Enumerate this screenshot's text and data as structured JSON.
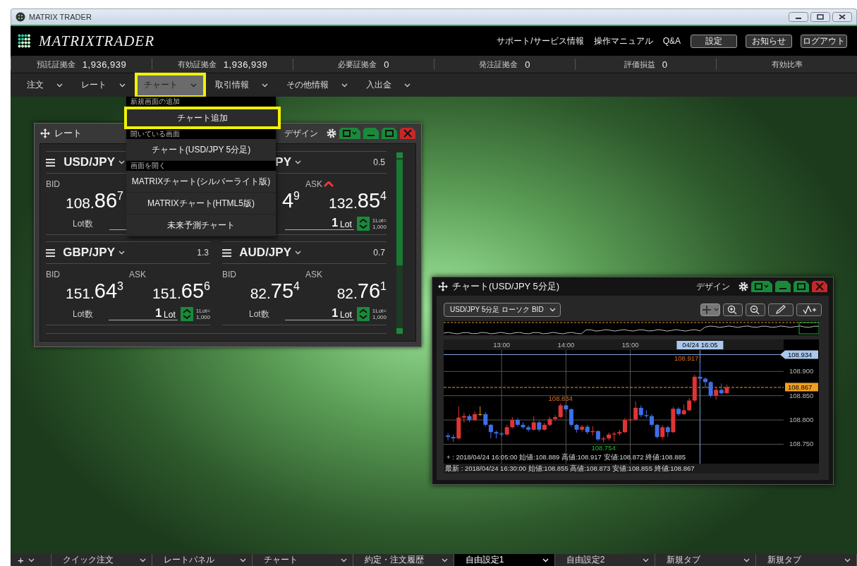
{
  "window": {
    "title": "MATRIX TRADER"
  },
  "header": {
    "logo": "MATRIXTRADER",
    "links": [
      "サポート/サービス情報",
      "操作マニュアル",
      "Q&A"
    ],
    "buttons": [
      "設定",
      "お知らせ",
      "ログアウト"
    ]
  },
  "account": [
    {
      "label": "預託証拠金",
      "value": "1,936,939"
    },
    {
      "label": "有効証拠金",
      "value": "1,936,939"
    },
    {
      "label": "必要証拠金",
      "value": "0"
    },
    {
      "label": "発注証拠金",
      "value": "0"
    },
    {
      "label": "評価損益",
      "value": "0"
    },
    {
      "label": "有効比率"
    }
  ],
  "menu": [
    {
      "label": "注文",
      "selected": false,
      "highlighted": false
    },
    {
      "label": "レート",
      "selected": false,
      "highlighted": false
    },
    {
      "label": "チャート",
      "selected": true,
      "highlighted": true
    },
    {
      "label": "取引情報",
      "selected": false,
      "highlighted": false
    },
    {
      "label": "その他情報",
      "selected": false,
      "highlighted": false
    },
    {
      "label": "入出金",
      "selected": false,
      "highlighted": false
    }
  ],
  "dropdown": [
    {
      "kind": "header",
      "label": "新規画面の追加"
    },
    {
      "kind": "item",
      "label": "チャート追加",
      "highlighted": true
    },
    {
      "kind": "header",
      "label": "開いている画面"
    },
    {
      "kind": "item",
      "label": "チャート(USD/JPY 5分足)",
      "highlighted": false
    },
    {
      "kind": "header",
      "label": "画面を開く"
    },
    {
      "kind": "item",
      "label": "MATRIXチャート(シルバーライト版)",
      "highlighted": false
    },
    {
      "kind": "item",
      "label": "MATRIXチャート(HTML5版)",
      "highlighted": false
    },
    {
      "kind": "item",
      "label": "未来予測チャート",
      "highlighted": false
    }
  ],
  "rate_window": {
    "title": "レート",
    "design": "デザイン",
    "pairs": [
      {
        "pair": "USD/JPY",
        "menu_icon": true,
        "bid": {
          "label": "BID",
          "int": "108.",
          "main": "86",
          "pip": "7",
          "rising": false
        },
        "lot": {
          "label": "Lot数"
        }
      },
      {
        "pair": "PY",
        "menu_icon": false,
        "spread": "0.5",
        "bid": {
          "main": "4",
          "pip": "9"
        },
        "ask": {
          "label": "ASK",
          "int": "132.",
          "main": "85",
          "pip": "4",
          "rising": true
        },
        "lot": {
          "value": "1",
          "unit": "Lot",
          "note": "1Lot=",
          "note_value": "1,000"
        }
      },
      {
        "pair": "GBP/JPY",
        "menu_icon": true,
        "spread": "1.3",
        "bid": {
          "label": "BID",
          "int": "151.",
          "main": "64",
          "pip": "3",
          "rising": false
        },
        "ask": {
          "label": "ASK",
          "int": "151.",
          "main": "65",
          "pip": "6",
          "rising": false
        },
        "lot": {
          "label": "Lot数",
          "value": "1",
          "unit": "Lot",
          "note": "1Lot=",
          "note_value": "1,000"
        }
      },
      {
        "pair": "AUD/JPY",
        "menu_icon": true,
        "spread": "0.7",
        "bid": {
          "label": "BID",
          "int": "82.",
          "main": "75",
          "pip": "4",
          "rising": false
        },
        "ask": {
          "label": "ASK",
          "int": "82.",
          "main": "76",
          "pip": "1",
          "rising": false
        },
        "lot": {
          "label": "Lot数",
          "value": "1",
          "unit": "Lot",
          "note": "1Lot=",
          "note_value": "1,000"
        }
      }
    ]
  },
  "chart_window": {
    "title": "チャート(USD/JPY 5分足)",
    "design": "デザイン",
    "selector": "USD/JPY 5分足 ローソク BID",
    "cursor_info": "+ : 2018/04/24 16:05:00 始値:108.889 高値:108.917 安値:108.872 終値:108.885",
    "latest_info": "最新 : 2018/04/24 16:30:00 始値:108.855 高値:108.873 安値:108.855 終値:108.867",
    "chart_data": {
      "type": "candlestick",
      "x": [
        730,
        735,
        740,
        745,
        750,
        755,
        760,
        765,
        770,
        775,
        780,
        785,
        790,
        795,
        800,
        805,
        810,
        815,
        820,
        825,
        830,
        835,
        840,
        845,
        850,
        855,
        860,
        865,
        870,
        875,
        880,
        885,
        890,
        895,
        900,
        905,
        910,
        915,
        920,
        925,
        930,
        935,
        940,
        945,
        950,
        955,
        960,
        965,
        970,
        975,
        980,
        985,
        990
      ],
      "ohlc": [
        [
          108.768,
          108.772,
          108.758,
          108.765
        ],
        [
          108.765,
          108.77,
          108.755,
          108.762
        ],
        [
          108.762,
          108.828,
          108.76,
          108.805
        ],
        [
          108.805,
          108.815,
          108.795,
          108.808
        ],
        [
          108.808,
          108.812,
          108.796,
          108.8
        ],
        [
          108.8,
          108.818,
          108.798,
          108.812
        ],
        [
          108.812,
          108.828,
          108.808,
          108.812
        ],
        [
          108.812,
          108.816,
          108.786,
          108.79
        ],
        [
          108.79,
          108.792,
          108.762,
          108.775
        ],
        [
          108.775,
          108.778,
          108.762,
          108.772
        ],
        [
          108.772,
          108.775,
          108.766,
          108.77
        ],
        [
          108.77,
          108.79,
          108.768,
          108.785
        ],
        [
          108.785,
          108.806,
          108.783,
          108.8
        ],
        [
          108.8,
          108.804,
          108.786,
          108.79
        ],
        [
          108.79,
          108.795,
          108.782,
          108.785
        ],
        [
          108.785,
          108.789,
          108.776,
          108.78
        ],
        [
          108.78,
          108.808,
          108.778,
          108.795
        ],
        [
          108.795,
          108.798,
          108.776,
          108.78
        ],
        [
          108.78,
          108.794,
          108.778,
          108.79
        ],
        [
          108.79,
          108.806,
          108.787,
          108.802
        ],
        [
          108.802,
          108.81,
          108.798,
          108.806
        ],
        [
          108.806,
          108.834,
          108.804,
          108.83
        ],
        [
          108.83,
          108.832,
          108.818,
          108.822
        ],
        [
          108.822,
          108.824,
          108.786,
          108.79
        ],
        [
          108.79,
          108.792,
          108.774,
          108.78
        ],
        [
          108.78,
          108.79,
          108.776,
          108.786
        ],
        [
          108.786,
          108.79,
          108.771,
          108.775
        ],
        [
          108.775,
          108.787,
          108.768,
          108.777
        ],
        [
          108.777,
          108.779,
          108.757,
          108.76
        ],
        [
          108.76,
          108.766,
          108.754,
          108.762
        ],
        [
          108.762,
          108.774,
          108.758,
          108.77
        ],
        [
          108.77,
          108.776,
          108.756,
          108.772
        ],
        [
          108.772,
          108.78,
          108.768,
          108.775
        ],
        [
          108.775,
          108.804,
          108.773,
          108.8
        ],
        [
          108.8,
          108.806,
          108.796,
          108.801
        ],
        [
          108.801,
          108.838,
          108.799,
          108.825
        ],
        [
          108.825,
          108.83,
          108.806,
          108.81
        ],
        [
          108.81,
          108.82,
          108.804,
          108.808
        ],
        [
          108.808,
          108.812,
          108.786,
          108.79
        ],
        [
          108.79,
          108.792,
          108.762,
          108.765
        ],
        [
          108.765,
          108.79,
          108.76,
          108.785
        ],
        [
          108.785,
          108.788,
          108.765,
          108.775
        ],
        [
          108.775,
          108.827,
          108.773,
          108.823
        ],
        [
          108.823,
          108.826,
          108.808,
          108.812
        ],
        [
          108.812,
          108.832,
          108.81,
          108.82
        ],
        [
          108.82,
          108.845,
          108.818,
          108.84
        ],
        [
          108.84,
          108.893,
          108.836,
          108.889
        ],
        [
          108.889,
          108.917,
          108.872,
          108.885
        ],
        [
          108.885,
          108.888,
          108.866,
          108.878
        ],
        [
          108.878,
          108.88,
          108.846,
          108.85
        ],
        [
          108.85,
          108.866,
          108.842,
          108.862
        ],
        [
          108.862,
          108.875,
          108.852,
          108.855
        ],
        [
          108.855,
          108.873,
          108.855,
          108.867
        ]
      ],
      "xlim": [
        726,
        1043
      ],
      "ylim": [
        108.71,
        108.944
      ],
      "xticks": [
        {
          "value": 780,
          "label": "13:00"
        },
        {
          "value": 840,
          "label": "14:00"
        },
        {
          "value": 900,
          "label": "15:00"
        }
      ],
      "yticks": [
        {
          "value": 108.9,
          "label": "108.900"
        },
        {
          "value": 108.85,
          "label": "108.850"
        },
        {
          "value": 108.8,
          "label": "108.800"
        },
        {
          "value": 108.75,
          "label": "108.750"
        }
      ],
      "grid": true,
      "ref_lines": [
        {
          "axis": "y",
          "value": 108.867,
          "color": "#e89a20"
        },
        {
          "axis": "x",
          "value": 965,
          "color": "#7fa8d8"
        }
      ],
      "annotations": [
        {
          "x": 965,
          "y": 108.917,
          "text": "108.917"
        },
        {
          "x": 835,
          "y": 108.834,
          "text": "108.834"
        },
        {
          "x": 875,
          "y": 108.754,
          "text": "108.754"
        }
      ]
    },
    "high_marker": "108.934",
    "last_marker": "108.867",
    "crosshair_time": "04/24 16:05"
  },
  "tab_bar": {
    "add": "+",
    "tabs": [
      {
        "label": "クイック注文",
        "selected": false
      },
      {
        "label": "レートパネル",
        "selected": false
      },
      {
        "label": "チャート",
        "selected": false
      },
      {
        "label": "約定・注文履歴",
        "selected": false
      },
      {
        "label": "自由設定1",
        "selected": true
      },
      {
        "label": "自由設定2",
        "selected": false
      },
      {
        "label": "新規タブ",
        "selected": false
      },
      {
        "label": "新規タブ",
        "selected": false
      }
    ]
  }
}
